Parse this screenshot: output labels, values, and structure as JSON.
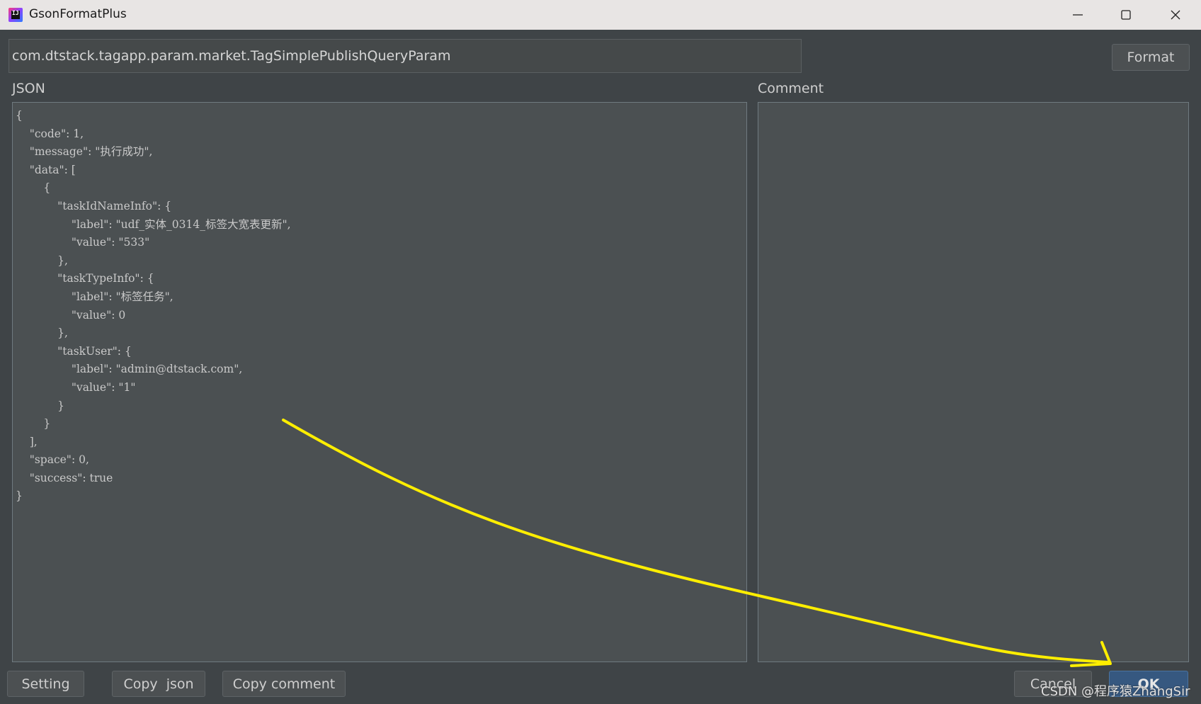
{
  "window": {
    "title": "GsonFormatPlus",
    "app_icon_text": "IJ"
  },
  "toolbar": {
    "class_name": "com.dtstack.tagapp.param.market.TagSimplePublishQueryParam",
    "format_label": "Format"
  },
  "json_panel": {
    "label": "JSON",
    "text": "{\n    \"code\": 1,\n    \"message\": \"执行成功\",\n    \"data\": [\n        {\n            \"taskIdNameInfo\": {\n                \"label\": \"udf_实体_0314_标签大宽表更新\",\n                \"value\": \"533\"\n            },\n            \"taskTypeInfo\": {\n                \"label\": \"标签任务\",\n                \"value\": 0\n            },\n            \"taskUser\": {\n                \"label\": \"admin@dtstack.com\",\n                \"value\": \"1\"\n            }\n        }\n    ],\n    \"space\": 0,\n    \"success\": true\n}"
  },
  "comment_panel": {
    "label": "Comment",
    "text": ""
  },
  "footer": {
    "setting_label": "Setting",
    "copy_json_label": "Copy  json",
    "copy_comment_label": "Copy comment",
    "cancel_label": "Cancel",
    "ok_label": "OK"
  },
  "watermark": "CSDN @程序猿ZhangSir",
  "colors": {
    "background": "#3f4447",
    "panel": "#4b5052",
    "ok_button": "#365880",
    "annotation": "#ffee00"
  }
}
